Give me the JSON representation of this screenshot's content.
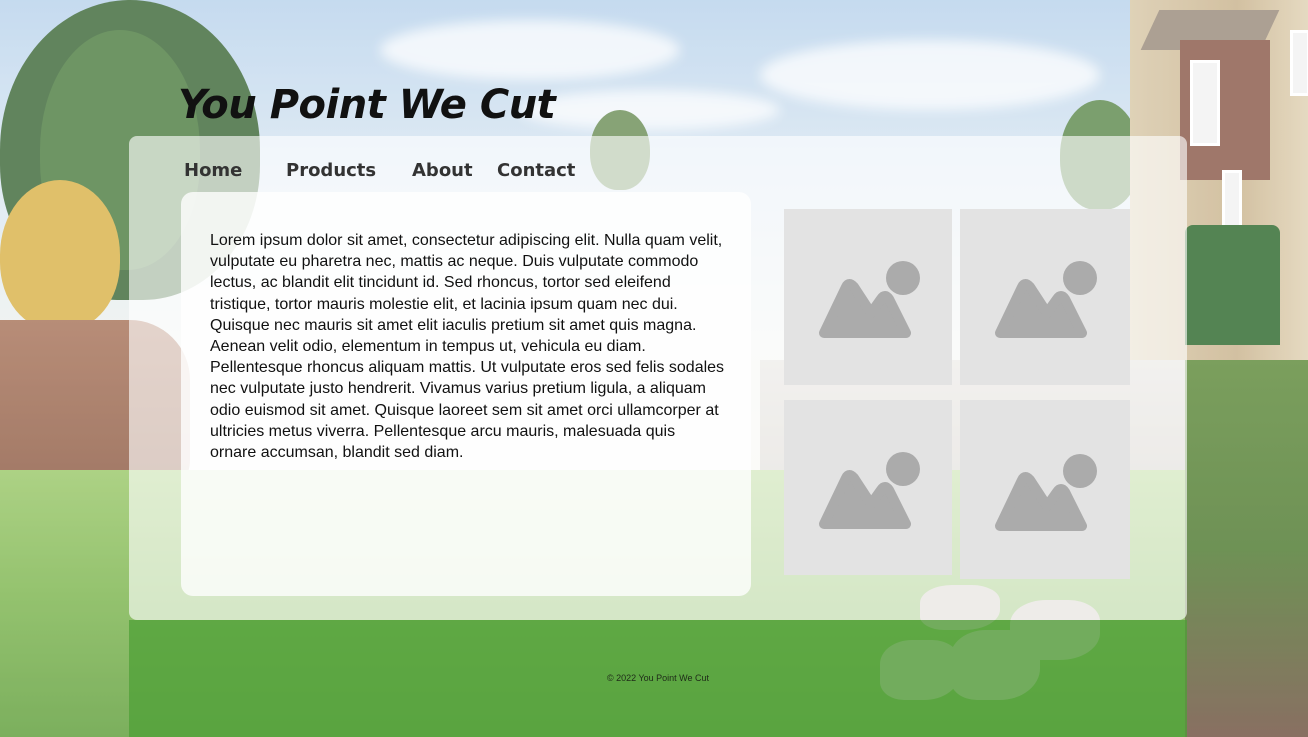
{
  "site": {
    "title": "You Point We Cut"
  },
  "nav": {
    "items": [
      {
        "label": "Home"
      },
      {
        "label": "Products"
      },
      {
        "label": "About"
      },
      {
        "label": "Contact"
      }
    ]
  },
  "main": {
    "body_text": "Lorem ipsum dolor sit amet, consectetur adipiscing elit. Nulla quam velit, vulputate eu pharetra nec, mattis ac neque. Duis vulputate commodo lectus, ac blandit elit tincidunt id. Sed rhoncus, tortor sed eleifend tristique, tortor mauris molestie elit, et lacinia ipsum quam nec dui. Quisque nec mauris sit amet elit iaculis pretium sit amet quis magna. Aenean velit odio, elementum in tempus ut, vehicula eu diam. Pellentesque rhoncus aliquam mattis. Ut vulputate eros sed felis sodales nec vulputate justo hendrerit. Vivamus varius pretium ligula, a aliquam odio euismod sit amet. Quisque laoreet sem sit amet orci ullamcorper at ultricies metus viverra. Pellentesque arcu mauris, malesuada quis ornare accumsan, blandit sed diam."
  },
  "gallery": {
    "images": [
      {
        "icon": "image-placeholder-icon"
      },
      {
        "icon": "image-placeholder-icon"
      },
      {
        "icon": "image-placeholder-icon"
      },
      {
        "icon": "image-placeholder-icon"
      }
    ]
  },
  "footer": {
    "copyright": "© 2022 You Point We Cut"
  },
  "colors": {
    "footer_green": "#4ca034",
    "placeholder_bg": "#e3e3e3",
    "placeholder_glyph": "#ababab",
    "text": "#111111",
    "nav_text": "#333333"
  }
}
